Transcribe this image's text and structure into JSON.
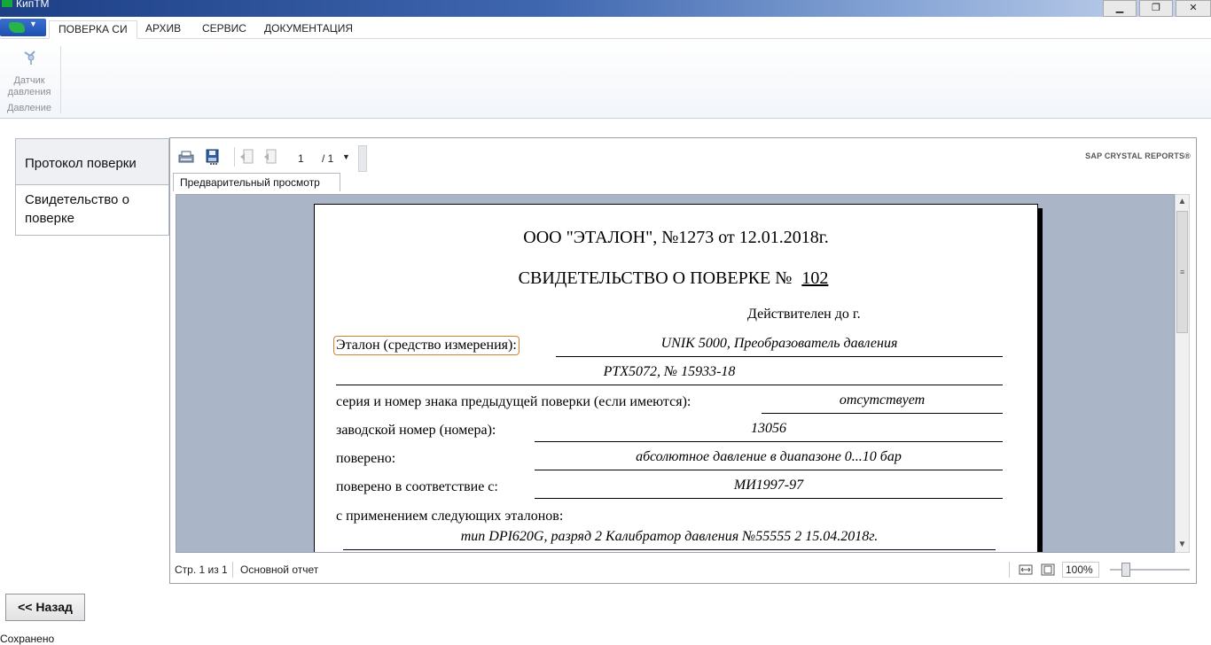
{
  "window": {
    "title": "КипТМ",
    "minimize": "▁",
    "restore": "❐",
    "close": "✕"
  },
  "ribbon": {
    "tabs": [
      "ПОВЕРКА СИ",
      "АРХИВ",
      "СЕРВИС",
      "ДОКУМЕНТАЦИЯ"
    ],
    "active_tab": "ПОВЕРКА СИ",
    "button_label": "Датчик давления",
    "group_label": "Давление"
  },
  "nav": {
    "protocol": "Протокол поверки",
    "certificate": "Свидетельство о поверке"
  },
  "viewer": {
    "page_current": "1",
    "page_total": "/ 1",
    "brand": "SAP CRYSTAL REPORTS®",
    "preview_tab": "Предварительный просмотр",
    "status_pages": "Стр. 1 из 1",
    "status_report": "Основной отчет",
    "zoom": "100%"
  },
  "document": {
    "org_line": "ООО \"ЭТАЛОН\", №1273 от 12.01.2018г.",
    "cert_title": "СВИДЕТЕЛЬСТВО О ПОВЕРКЕ №",
    "cert_number": "102",
    "valid_until": "Действителен до г.",
    "etalon_label": "Эталон (средство измерения):",
    "etalon_value": "UNIK 5000, Преобразователь давления",
    "etalon_value2": "PTX5072, № 15933-18",
    "prev_mark_label": "серия и номер знака предыдущей поверки (если имеются):",
    "prev_mark_value": "отсутствует",
    "serial_label": "заводской номер (номера):",
    "serial_value": "13056",
    "verified_label": "поверено:",
    "verified_value": "абсолютное давление в диапазоне 0...10 бар",
    "according_label": "поверено в соответствие с:",
    "according_value": "МИ1997-97",
    "standards_label": "с применением следующих эталонов:",
    "standards_value": "тип DPI620G, разряд 2 Калибратор давления №55555 2 15.04.2018г."
  },
  "footer": {
    "back_label": "<< Назад",
    "status": "Сохранено"
  },
  "colors": {
    "titlebar": "#1d3f86",
    "preview_bg": "#aab5c8",
    "focus_outline": "#d4832c"
  }
}
